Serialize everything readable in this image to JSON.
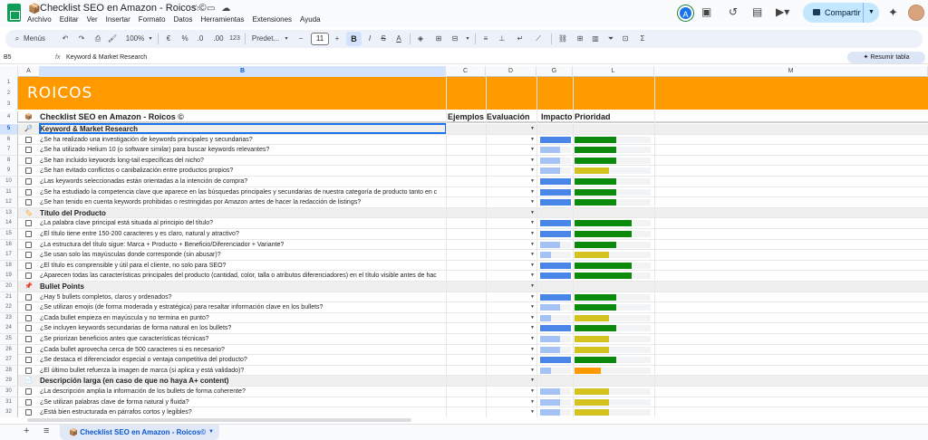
{
  "app": {
    "doc_emoji": "📦",
    "title": "Checklist SEO en Amazon - Roicos ©",
    "menu": [
      "Archivo",
      "Editar",
      "Ver",
      "Insertar",
      "Formato",
      "Datos",
      "Herramientas",
      "Extensiones",
      "Ayuda"
    ],
    "avatar_letter": "A",
    "share_label": "Compartir"
  },
  "toolbar": {
    "menus_label": "Menús",
    "zoom": "100%",
    "currency": "€",
    "percent": "%",
    "dec_less": ".0",
    "dec_more": ".00",
    "number_fmt": "123",
    "font": "Predet...",
    "font_size": "11",
    "bold": "B"
  },
  "formula_bar": {
    "cell_ref": "B5",
    "fx": "fx",
    "content": "Keyword & Market Research",
    "summary_button": "Resumir tabla"
  },
  "columns": [
    "A",
    "B",
    "C",
    "D",
    "G",
    "L",
    "M"
  ],
  "brand": "ROICOS",
  "header_row": {
    "row_num": "4",
    "title": "Checklist SEO en Amazon - Roicos ©",
    "ejemplos": "Ejemplos",
    "evaluacion": "Evaluación",
    "impacto": "Impacto",
    "prioridad": "Prioridad"
  },
  "colors": {
    "brand_orange": "#ff9900",
    "impact_high": "#4a86e8",
    "impact_low": "#a4c2f4",
    "priority_high": "#0b8a0b",
    "priority_mid": "#d4c21f",
    "priority_orange": "#ff9900"
  },
  "rows": [
    {
      "n": "5",
      "type": "section",
      "icon": "🔎",
      "text": "Keyword & Market Research"
    },
    {
      "n": "6",
      "type": "item",
      "text": "¿Se ha realizado una investigación de keywords principales y secundarias?",
      "impact": 1.0,
      "priority": 0.55,
      "pcolor": "green"
    },
    {
      "n": "7",
      "type": "item",
      "text": "¿Se ha utilizado Helium 10 (o software similar) para buscar keywords relevantes?",
      "impact": 0.65,
      "priority": 0.55,
      "pcolor": "green"
    },
    {
      "n": "8",
      "type": "item",
      "text": "¿Se han incluido keywords long-tail específicas del nicho?",
      "impact": 0.65,
      "priority": 0.55,
      "pcolor": "green"
    },
    {
      "n": "9",
      "type": "item",
      "text": "¿Se han evitado conflictos o canibalización entre productos propios?",
      "impact": 0.65,
      "priority": 0.45,
      "pcolor": "yellow"
    },
    {
      "n": "10",
      "type": "item",
      "text": "¿Las keywords seleccionadas están orientadas a la intención de compra?",
      "impact": 1.0,
      "priority": 0.55,
      "pcolor": "green"
    },
    {
      "n": "11",
      "type": "item",
      "text": "¿Se ha estudiado la competencia clave que aparece en las búsquedas principales y secundarias de nuestra categoría de producto tanto en c",
      "impact": 1.0,
      "priority": 0.55,
      "pcolor": "green"
    },
    {
      "n": "12",
      "type": "item",
      "text": "¿Se han tenido en cuenta keywords prohibidas o restringidas por Amazon antes de hacer la redacción de listings?",
      "impact": 1.0,
      "priority": 0.55,
      "pcolor": "green"
    },
    {
      "n": "13",
      "type": "section",
      "icon": "🏷️",
      "text": "Título del Producto"
    },
    {
      "n": "14",
      "type": "item",
      "text": "¿La palabra clave principal está situada al principio del título?",
      "impact": 1.0,
      "priority": 0.75,
      "pcolor": "green"
    },
    {
      "n": "15",
      "type": "item",
      "text": "¿El título tiene entre 150-200 caracteres y es claro, natural y atractivo?",
      "impact": 1.0,
      "priority": 0.75,
      "pcolor": "green"
    },
    {
      "n": "16",
      "type": "item",
      "text": "¿La estructura del título sigue: Marca + Producto + Beneficio/Diferenciador + Variante?",
      "impact": 0.65,
      "priority": 0.55,
      "pcolor": "green"
    },
    {
      "n": "17",
      "type": "item",
      "text": "¿Se usan solo las mayúsculas donde corresponde (sin abusar)?",
      "impact": 0.35,
      "priority": 0.45,
      "pcolor": "yellow"
    },
    {
      "n": "18",
      "type": "item",
      "text": "¿El título es comprensible y útil para el cliente, no solo para SEO?",
      "impact": 1.0,
      "priority": 0.75,
      "pcolor": "green"
    },
    {
      "n": "19",
      "type": "item",
      "text": "¿Aparecen todas las características principales del producto (cantidad, color, talla o atributos diferenciadores) en el título visible antes de hac",
      "impact": 1.0,
      "priority": 0.75,
      "pcolor": "green"
    },
    {
      "n": "20",
      "type": "section",
      "icon": "📌",
      "text": "Bullet Points"
    },
    {
      "n": "21",
      "type": "item",
      "text": "¿Hay 5 bullets completos, claros y ordenados?",
      "impact": 1.0,
      "priority": 0.55,
      "pcolor": "green"
    },
    {
      "n": "22",
      "type": "item",
      "text": "¿Se utilizan emojis (de forma moderada y estratégica) para resaltar información clave en los bullets?",
      "impact": 0.65,
      "priority": 0.55,
      "pcolor": "green"
    },
    {
      "n": "23",
      "type": "item",
      "text": "¿Cada bullet empieza en mayúscula y no termina en punto?",
      "impact": 0.35,
      "priority": 0.45,
      "pcolor": "yellow"
    },
    {
      "n": "24",
      "type": "item",
      "text": "¿Se incluyen keywords secundarias de forma natural en los bullets?",
      "impact": 1.0,
      "priority": 0.55,
      "pcolor": "green"
    },
    {
      "n": "25",
      "type": "item",
      "text": "¿Se priorizan beneficios antes que características técnicas?",
      "impact": 0.65,
      "priority": 0.45,
      "pcolor": "yellow"
    },
    {
      "n": "26",
      "type": "item",
      "text": "¿Cada bullet aprovecha cerca de 500 caracteres si es necesario?",
      "impact": 0.65,
      "priority": 0.45,
      "pcolor": "yellow"
    },
    {
      "n": "27",
      "type": "item",
      "text": "¿Se destaca el diferenciador especial o ventaja competitiva del producto?",
      "impact": 1.0,
      "priority": 0.55,
      "pcolor": "green"
    },
    {
      "n": "28",
      "type": "item",
      "text": "¿El último bullet refuerza la imagen de marca (si aplica y está validado)?",
      "impact": 0.35,
      "priority": 0.35,
      "pcolor": "orange"
    },
    {
      "n": "29",
      "type": "section",
      "icon": "📄",
      "text": "Descripción larga (en caso de que no haya A+ content)"
    },
    {
      "n": "30",
      "type": "item",
      "text": "¿La descripción amplia la información de los bullets de forma coherente?",
      "impact": 0.65,
      "priority": 0.45,
      "pcolor": "yellow"
    },
    {
      "n": "31",
      "type": "item",
      "text": "¿Se utilizan palabras clave de forma natural y fluida?",
      "impact": 0.65,
      "priority": 0.45,
      "pcolor": "yellow"
    },
    {
      "n": "32",
      "type": "item",
      "text": "¿Está bien estructurada en párrafos cortos y legibles?",
      "impact": 0.65,
      "priority": 0.45,
      "pcolor": "yellow"
    }
  ],
  "sheet_tab": {
    "emoji": "📦",
    "label": "Checklist SEO en Amazon - Roicos©"
  }
}
